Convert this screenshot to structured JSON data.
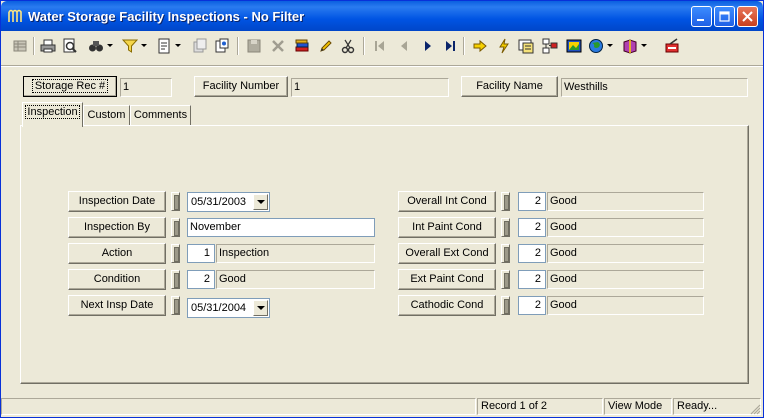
{
  "window": {
    "title": "Water Storage Facility Inspections - No Filter",
    "title_color": "#0054E3"
  },
  "toolbar": {
    "icons": [
      "table-icon",
      "print-icon",
      "print-preview-icon",
      "search-binoculars-icon",
      "filter-icon",
      "report-icon",
      "copy-record-icon",
      "new-record-icon",
      "save-icon",
      "delete-icon",
      "books-icon",
      "edit-pencil-icon",
      "cut-icon",
      "first-record-icon",
      "prev-record-icon",
      "next-record-icon",
      "last-record-icon",
      "go-to-icon",
      "lightning-icon",
      "map-icon",
      "hierarchy-icon",
      "image-icon",
      "globe-icon",
      "book-icon",
      "exit-icon"
    ]
  },
  "header": {
    "storage_rec_label": "Storage Rec #",
    "storage_rec_value": "1",
    "facility_number_label": "Facility Number",
    "facility_number_value": "1",
    "facility_name_label": "Facility Name",
    "facility_name_value": "Westhills"
  },
  "tabs": [
    {
      "label": "Inspection",
      "active": true
    },
    {
      "label": "Custom",
      "active": false
    },
    {
      "label": "Comments",
      "active": false
    }
  ],
  "inspection": {
    "inspection_date": {
      "label": "Inspection Date",
      "value": "05/31/2003"
    },
    "inspection_by": {
      "label": "Inspection By",
      "value": "November"
    },
    "action": {
      "label": "Action",
      "code": "1",
      "text": "Inspection"
    },
    "condition": {
      "label": "Condition",
      "code": "2",
      "text": "Good"
    },
    "next_insp_date": {
      "label": "Next Insp Date",
      "value": "05/31/2004"
    }
  },
  "conditions": [
    {
      "label": "Overall Int Cond",
      "code": "2",
      "text": "Good"
    },
    {
      "label": "Int Paint Cond",
      "code": "2",
      "text": "Good"
    },
    {
      "label": "Overall Ext Cond",
      "code": "2",
      "text": "Good"
    },
    {
      "label": "Ext Paint Cond",
      "code": "2",
      "text": "Good"
    },
    {
      "label": "Cathodic Cond",
      "code": "2",
      "text": "Good"
    }
  ],
  "status": {
    "record": "Record 1 of 2",
    "mode": "View Mode",
    "state": "Ready..."
  }
}
